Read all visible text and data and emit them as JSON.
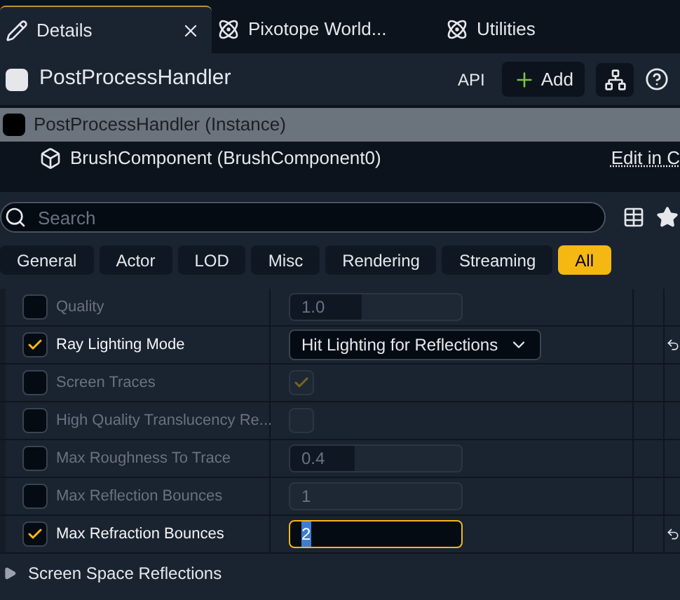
{
  "tabs": [
    {
      "label": "Details",
      "selected": true,
      "closable": true
    },
    {
      "label": "Pixotope World...",
      "selected": false,
      "closable": false
    },
    {
      "label": "Utilities",
      "selected": false,
      "closable": false
    }
  ],
  "header": {
    "title": "PostProcessHandler",
    "api": "API",
    "add": "Add"
  },
  "components": [
    {
      "label": "PostProcessHandler (Instance)",
      "selected": true,
      "kind": "instance"
    },
    {
      "label": "BrushComponent (BrushComponent0)",
      "selected": false,
      "kind": "brush",
      "link": "Edit in C"
    }
  ],
  "search": {
    "placeholder": "Search"
  },
  "categories": [
    {
      "label": "General",
      "selected": false
    },
    {
      "label": "Actor",
      "selected": false
    },
    {
      "label": "LOD",
      "selected": false
    },
    {
      "label": "Misc",
      "selected": false
    },
    {
      "label": "Rendering",
      "selected": false
    },
    {
      "label": "Streaming",
      "selected": false
    },
    {
      "label": "All",
      "selected": true
    }
  ],
  "properties": [
    {
      "label": "Quality",
      "checked": false,
      "kind": "slider",
      "value": "1.0",
      "level": 0.42
    },
    {
      "label": "Ray Lighting Mode",
      "checked": true,
      "kind": "dropdown",
      "value": "Hit Lighting for Reflections"
    },
    {
      "label": "Screen Traces",
      "checked": false,
      "kind": "checkbox",
      "on": true
    },
    {
      "label": "High Quality Translucency Re...",
      "checked": false,
      "kind": "checkbox",
      "on": false
    },
    {
      "label": "Max Roughness To Trace",
      "checked": false,
      "kind": "slider",
      "value": "0.4",
      "level": 0.38
    },
    {
      "label": "Max Reflection Bounces",
      "checked": false,
      "kind": "number",
      "value": "1",
      "focused": false
    },
    {
      "label": "Max Refraction Bounces",
      "checked": true,
      "kind": "number",
      "value": "2",
      "focused": true
    }
  ],
  "section": {
    "label": "Screen Space Reflections",
    "expanded": false
  }
}
